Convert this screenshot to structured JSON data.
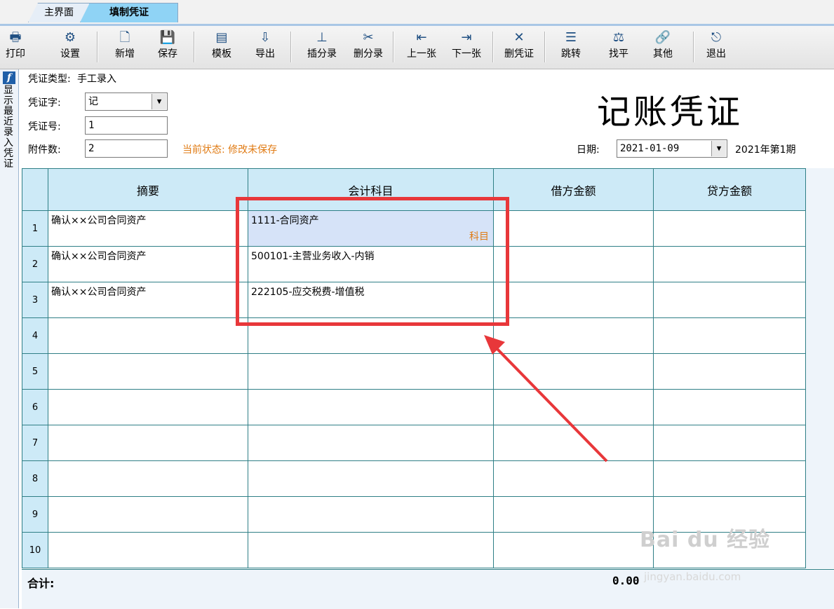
{
  "tabs": [
    {
      "label": "主界面"
    },
    {
      "label": "填制凭证"
    }
  ],
  "toolbar": [
    {
      "label": "打印",
      "icon": "printer-icon",
      "glyph": "🖶"
    },
    {
      "label": "设置",
      "icon": "settings-icon",
      "glyph": "⚙"
    },
    {
      "label": "新增",
      "icon": "new-doc-icon",
      "glyph": "🗋"
    },
    {
      "label": "保存",
      "icon": "save-icon",
      "glyph": "💾"
    },
    {
      "label": "模板",
      "icon": "template-icon",
      "glyph": "▤"
    },
    {
      "label": "导出",
      "icon": "export-icon",
      "glyph": "⇩"
    },
    {
      "label": "插分录",
      "icon": "insert-entry-icon",
      "glyph": "⊥"
    },
    {
      "label": "删分录",
      "icon": "delete-entry-icon",
      "glyph": "✂"
    },
    {
      "label": "上一张",
      "icon": "prev-icon",
      "glyph": "⇤"
    },
    {
      "label": "下一张",
      "icon": "next-icon",
      "glyph": "⇥"
    },
    {
      "label": "删凭证",
      "icon": "delete-voucher-icon",
      "glyph": "✕"
    },
    {
      "label": "跳转",
      "icon": "jump-icon",
      "glyph": "☰"
    },
    {
      "label": "找平",
      "icon": "balance-icon",
      "glyph": "⚖"
    },
    {
      "label": "其他",
      "icon": "link-icon",
      "glyph": "🔗"
    },
    {
      "label": "退出",
      "icon": "exit-icon",
      "glyph": "⎋"
    }
  ],
  "sidebar": {
    "label": "显示最近录入凭证"
  },
  "header": {
    "voucher_type_label": "凭证类型:",
    "voucher_type_value": "手工录入",
    "voucher_word_label": "凭证字:",
    "voucher_word_value": "记",
    "voucher_no_label": "凭证号:",
    "voucher_no_value": "1",
    "attachments_label": "附件数:",
    "attachments_value": "2",
    "status": "当前状态: 修改未保存",
    "title": "记账凭证",
    "date_label": "日期:",
    "date_value": "2021-01-09",
    "period": "2021年第1期"
  },
  "grid": {
    "columns": [
      "摘要",
      "会计科目",
      "借方金额",
      "贷方金额"
    ],
    "rows": [
      {
        "no": "1",
        "summary": "确认××公司合同资产",
        "account": "1111-合同资产",
        "debit": "",
        "credit": "",
        "tag": "科目"
      },
      {
        "no": "2",
        "summary": "确认××公司合同资产",
        "account": "500101-主营业务收入-内销",
        "debit": "",
        "credit": ""
      },
      {
        "no": "3",
        "summary": "确认××公司合同资产",
        "account": "222105-应交税费-增值税",
        "debit": "",
        "credit": ""
      },
      {
        "no": "4",
        "summary": "",
        "account": "",
        "debit": "",
        "credit": ""
      },
      {
        "no": "5",
        "summary": "",
        "account": "",
        "debit": "",
        "credit": ""
      },
      {
        "no": "6",
        "summary": "",
        "account": "",
        "debit": "",
        "credit": ""
      },
      {
        "no": "7",
        "summary": "",
        "account": "",
        "debit": "",
        "credit": ""
      },
      {
        "no": "8",
        "summary": "",
        "account": "",
        "debit": "",
        "credit": ""
      },
      {
        "no": "9",
        "summary": "",
        "account": "",
        "debit": "",
        "credit": ""
      },
      {
        "no": "10",
        "summary": "",
        "account": "",
        "debit": "",
        "credit": ""
      }
    ]
  },
  "footer": {
    "total_label": "合计:",
    "total_value": "0.00"
  },
  "watermark": {
    "main": "Bai du 经验",
    "sub": "jingyan.baidu.com"
  },
  "colors": {
    "accent_orange": "#e07b14",
    "annotation_red": "#e8373a",
    "grid_line": "#2f7f86",
    "header_bg": "#cdeaf7"
  }
}
